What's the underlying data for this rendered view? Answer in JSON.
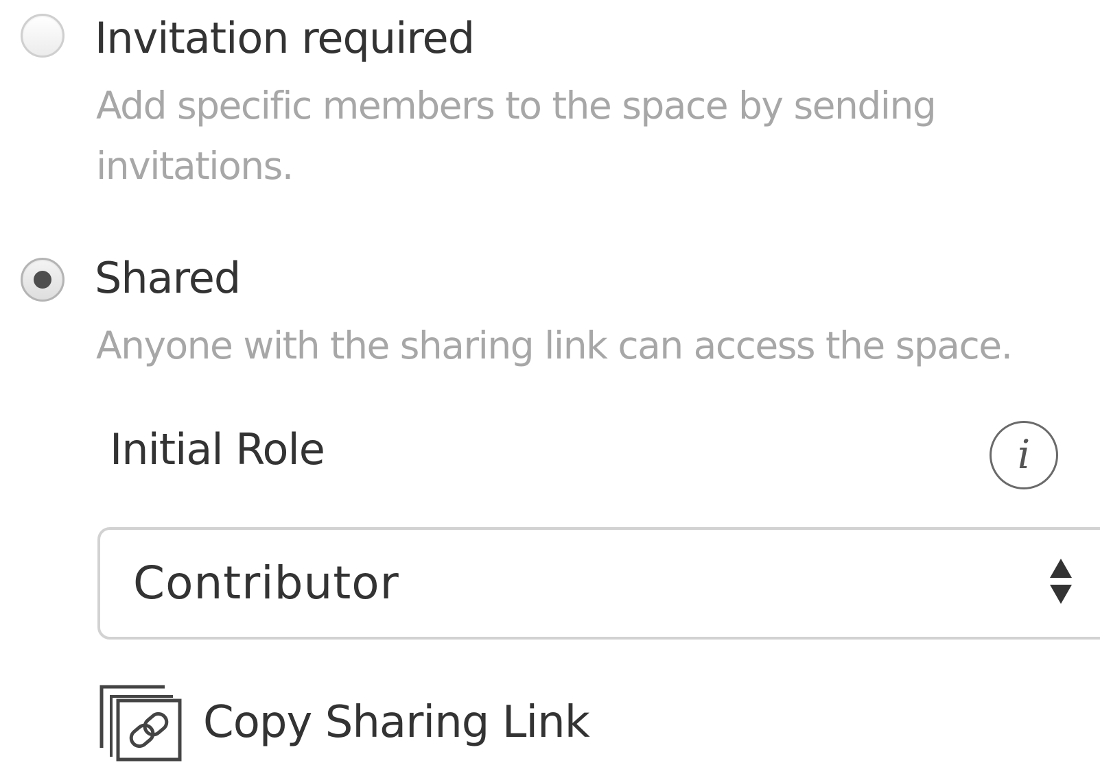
{
  "access": {
    "options": [
      {
        "label": "Invitation required",
        "description": "Add specific members to the space by sending invitations.",
        "selected": false
      },
      {
        "label": "Shared",
        "description": "Anyone with the sharing link can access the space.",
        "selected": true
      }
    ]
  },
  "initial_role": {
    "label": "Initial Role",
    "info_glyph": "i",
    "icon": "info-icon",
    "selected_value": "Contributor",
    "select_icon": "up-down-arrows-icon"
  },
  "copy_link": {
    "label": "Copy Sharing Link",
    "icon": "copy-link-icon"
  },
  "colors": {
    "text": "#333333",
    "description": "#a7a7a7",
    "border": "#d2d2d2",
    "radio_dot": "#4e4e4e"
  }
}
